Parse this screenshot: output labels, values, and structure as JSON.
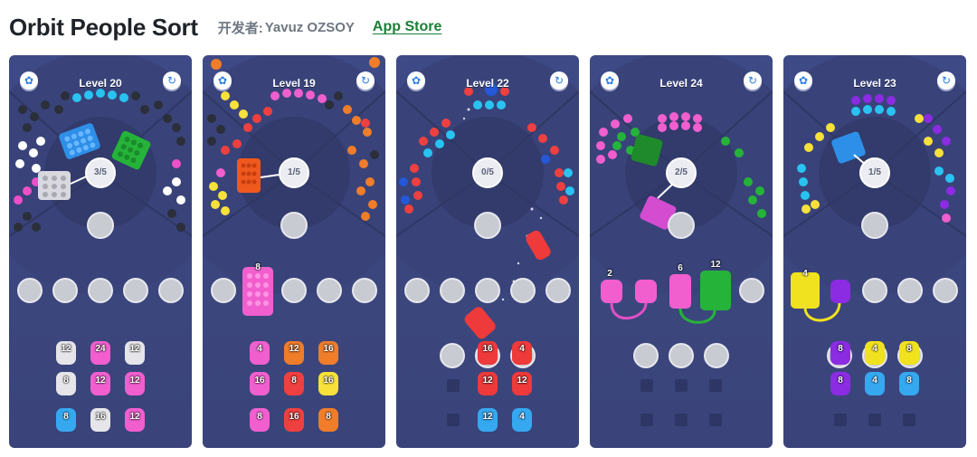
{
  "header": {
    "title": "Orbit People Sort",
    "developer_label": "开发者:",
    "developer_name": "Yavuz OZSOY",
    "store_link": "App Store"
  },
  "colors": {
    "panel": "#3d4882",
    "center": "#343d6f",
    "slot": "#c9cbd2"
  },
  "screenshots": [
    {
      "level": "Level 20",
      "progress": "3/5",
      "settings_icon": "gear-icon",
      "restart_icon": "restart-icon",
      "counts": [
        "12",
        "24",
        "12",
        "8",
        "12",
        "12",
        "8",
        "16",
        "12"
      ]
    },
    {
      "level": "Level 19",
      "progress": "1/5",
      "settings_icon": "gear-icon",
      "restart_icon": "restart-icon",
      "block_count": "8",
      "counts": [
        "4",
        "12",
        "16",
        "16",
        "8",
        "16",
        "8",
        "16",
        "8"
      ]
    },
    {
      "level": "Level 22",
      "progress": "0/5",
      "settings_icon": "gear-icon",
      "restart_icon": "restart-icon",
      "counts": [
        "16",
        "4",
        "12",
        "12",
        "12",
        "4"
      ]
    },
    {
      "level": "Level 24",
      "progress": "2/5",
      "settings_icon": "gear-icon",
      "restart_icon": "restart-icon",
      "block_counts": [
        "2",
        "6",
        "12"
      ]
    },
    {
      "level": "Level 23",
      "progress": "1/5",
      "settings_icon": "gear-icon",
      "restart_icon": "restart-icon",
      "block_counts": [
        "4"
      ],
      "counts": [
        "8",
        "4",
        "8",
        "8",
        "4",
        "8"
      ]
    }
  ]
}
